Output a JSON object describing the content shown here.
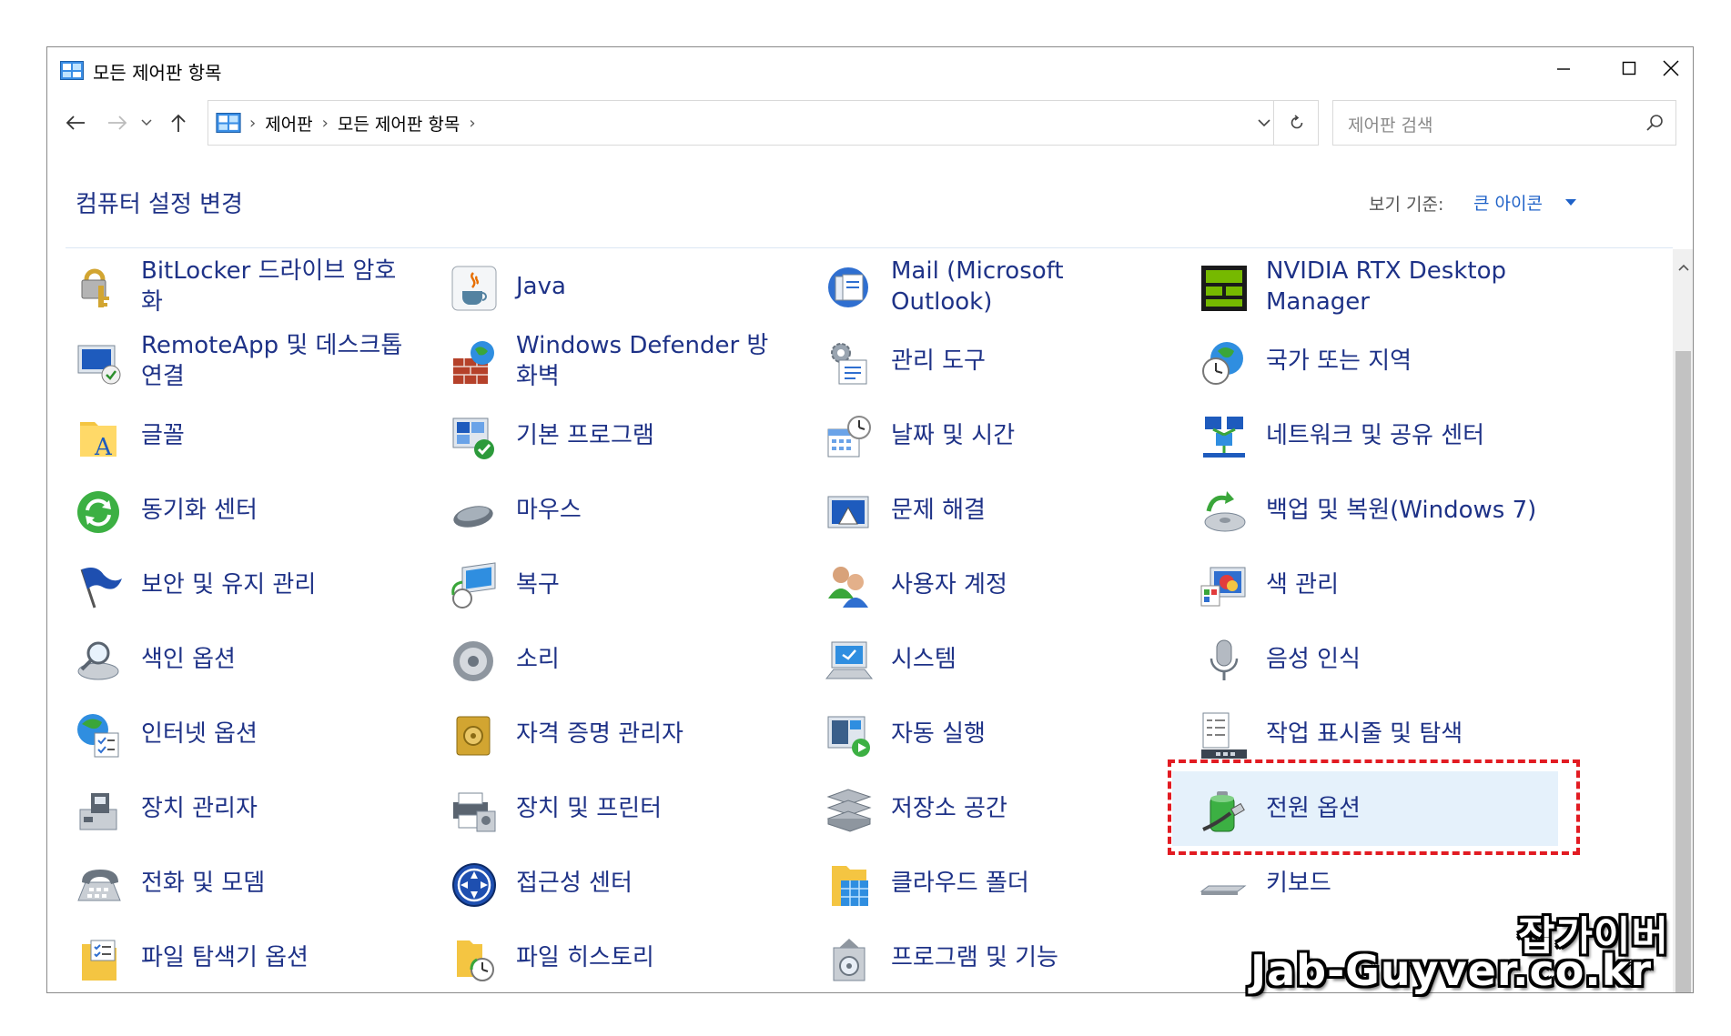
{
  "window": {
    "title": "모든 제어판 항목"
  },
  "address": {
    "crumbs": [
      "제어판",
      "모든 제어판 항목"
    ],
    "search_placeholder": "제어판 검색"
  },
  "header": {
    "title": "컴퓨터 설정 변경",
    "view_by_label": "보기 기준:",
    "view_by_value": "큰 아이콘"
  },
  "items": [
    [
      "BitLocker 드라이브 암호화",
      "Java",
      "Mail (Microsoft Outlook)",
      "NVIDIA RTX Desktop Manager"
    ],
    [
      "RemoteApp 및 데스크톱 연결",
      "Windows Defender 방화벽",
      "관리 도구",
      "국가 또는 지역"
    ],
    [
      "글꼴",
      "기본 프로그램",
      "날짜 및 시간",
      "네트워크 및 공유 센터"
    ],
    [
      "동기화 센터",
      "마우스",
      "문제 해결",
      "백업 및 복원(Windows 7)"
    ],
    [
      "보안 및 유지 관리",
      "복구",
      "사용자 계정",
      "색 관리"
    ],
    [
      "색인 옵션",
      "소리",
      "시스템",
      "음성 인식"
    ],
    [
      "인터넷 옵션",
      "자격 증명 관리자",
      "자동 실행",
      "작업 표시줄 및 탐색"
    ],
    [
      "장치 관리자",
      "장치 및 프린터",
      "저장소 공간",
      "전원 옵션"
    ],
    [
      "전화 및 모뎀",
      "접근성 센터",
      "클라우드 폴더",
      "키보드"
    ],
    [
      "파일 탐색기 옵션",
      "파일 히스토리",
      "프로그램 및 기능",
      ""
    ]
  ],
  "highlighted_item": "전원 옵션",
  "watermark": {
    "line1": "잡가이버",
    "line2": "Jab-Guyver.co.kr"
  },
  "colors": {
    "link": "#1e3287",
    "accent": "#1f62c8",
    "highlight_bg": "#e5f1fb",
    "annotation": "#e21b22"
  }
}
